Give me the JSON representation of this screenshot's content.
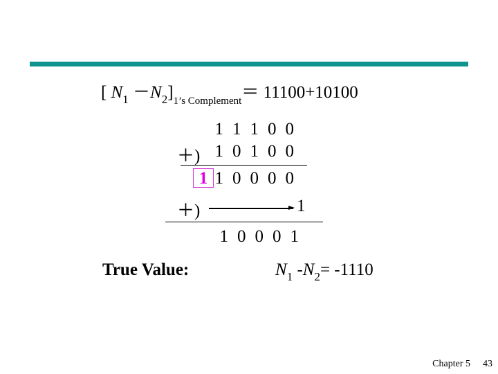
{
  "header_rule_color": "#0f9490",
  "equation": {
    "open_bracket": "[",
    "n1_var": "N",
    "n1_sub": "1",
    "minus": "－",
    "n2_var": "N",
    "n2_sub": "2",
    "close_bracket": "]",
    "subscript": "1’s Complement",
    "equals": "＝",
    "rhs": "11100+10100"
  },
  "addition": {
    "row1_digits": [
      "1",
      "1",
      "1",
      "0",
      "0"
    ],
    "row2_operator": "＋)",
    "row2_digits": [
      "1",
      "0",
      "1",
      "0",
      "0"
    ],
    "carry_digit": "1",
    "carry_color": "#e000e0",
    "row3_digits": [
      "1",
      "0",
      "0",
      "0",
      "0"
    ],
    "row4_operator": "＋)",
    "row4_end_digit": "1",
    "result_digits": [
      "1",
      "0",
      "0",
      "0",
      "1"
    ]
  },
  "true_value": {
    "label": "True Value:",
    "n1_var": "N",
    "n1_sub": "1",
    "minus": " -",
    "n2_var": "N",
    "n2_sub": "2",
    "equals_value": "= -1110"
  },
  "footer": {
    "chapter": "Chapter 5",
    "page": "43"
  }
}
